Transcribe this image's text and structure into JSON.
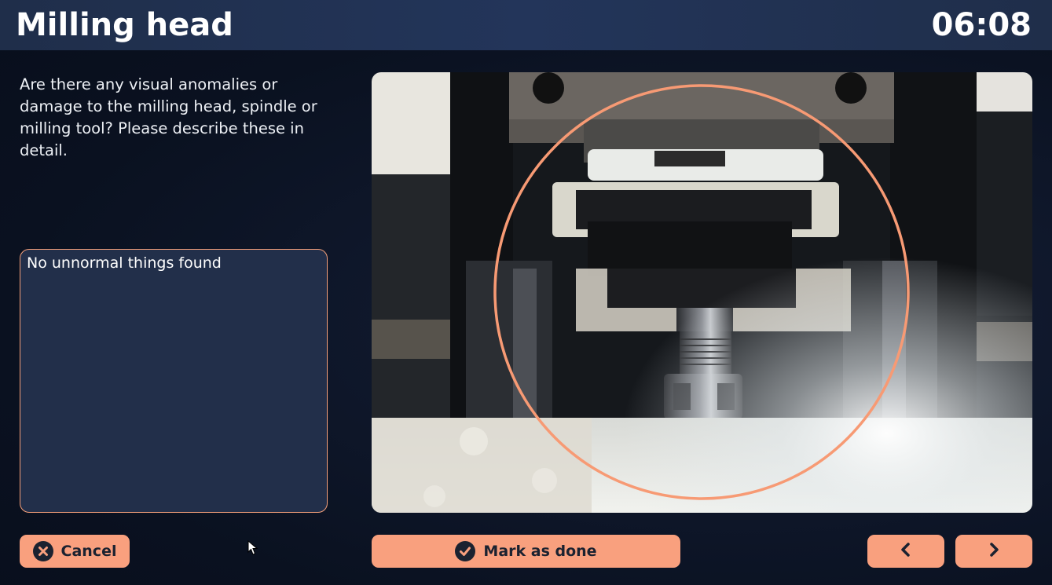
{
  "header": {
    "title": "Milling head",
    "timer": "06:08"
  },
  "question": {
    "text": "Are there any visual anomalies or damage to the milling head, spindle or milling tool? Please describe these in detail."
  },
  "answer": {
    "value": "No unnormal things found"
  },
  "photo": {
    "subject": "milling head photo with highlight circle",
    "highlight_color": "#f79a74"
  },
  "buttons": {
    "cancel_label": "Cancel",
    "cancel_icon": "close-circle-icon",
    "done_label": "Mark as done",
    "done_icon": "check-circle-icon",
    "prev_icon": "chevron-left-icon",
    "next_icon": "chevron-right-icon"
  },
  "colors": {
    "accent": "#f9a07e",
    "background": "#0c1426",
    "header": "#23355a",
    "field": "#222f4a"
  }
}
